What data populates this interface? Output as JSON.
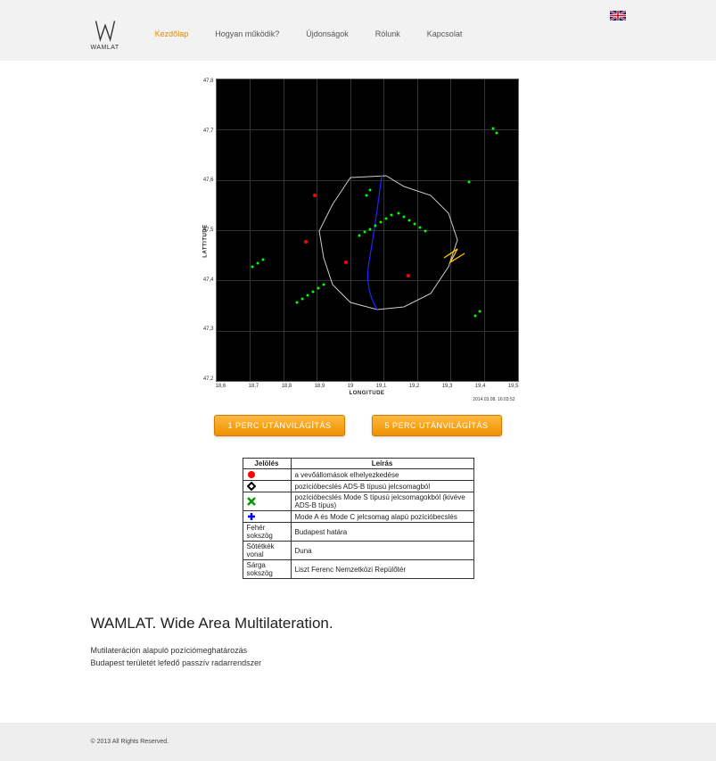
{
  "header": {
    "logo_text": "WAMLAT",
    "nav": [
      {
        "label": "Kezdőlap",
        "active": true
      },
      {
        "label": "Hogyan működik?",
        "active": false
      },
      {
        "label": "Újdonságok",
        "active": false
      },
      {
        "label": "Rólunk",
        "active": false
      },
      {
        "label": "Kapcsolat",
        "active": false
      }
    ],
    "flag_name": "uk-flag"
  },
  "chart_data": {
    "type": "scatter",
    "title": "",
    "xlabel": "LONGITUDE",
    "ylabel": "LATTITUDE",
    "xlim": [
      18.6,
      19.5
    ],
    "ylim": [
      47.2,
      47.8
    ],
    "xticks": [
      "18,6",
      "18,7",
      "18,8",
      "18,9",
      "19",
      "19,1",
      "19,2",
      "19,3",
      "19,4",
      "19,5"
    ],
    "yticks": [
      "47,8",
      "47,7",
      "47,6",
      "47,5",
      "47,4",
      "47,3",
      "47,2"
    ],
    "timestamp": "2014.03.08. 16:03:52",
    "series": [
      {
        "name": "receivers",
        "color": "#ff0000",
        "points": [
          [
            18.98,
            47.44
          ],
          [
            19.17,
            47.41
          ],
          [
            18.85,
            47.48
          ],
          [
            18.87,
            47.58
          ]
        ]
      },
      {
        "name": "ads-b",
        "color": "#00ff00",
        "points": [
          [
            18.68,
            47.42
          ],
          [
            18.7,
            47.43
          ],
          [
            18.72,
            47.44
          ],
          [
            18.82,
            47.35
          ],
          [
            18.84,
            47.36
          ],
          [
            18.86,
            47.37
          ],
          [
            18.88,
            47.38
          ],
          [
            18.9,
            47.39
          ],
          [
            19.04,
            47.48
          ],
          [
            19.06,
            47.49
          ],
          [
            19.08,
            47.5
          ],
          [
            19.1,
            47.51
          ],
          [
            19.12,
            47.52
          ],
          [
            19.14,
            47.53
          ],
          [
            19.16,
            47.52
          ],
          [
            19.18,
            47.51
          ],
          [
            19.2,
            47.5
          ],
          [
            19.22,
            47.49
          ],
          [
            19.24,
            47.48
          ],
          [
            19.35,
            47.6
          ],
          [
            19.38,
            47.3
          ],
          [
            18.97,
            47.56
          ],
          [
            18.99,
            47.575
          ],
          [
            19.33,
            47.73
          ],
          [
            19.34,
            47.34
          ],
          [
            19.32,
            47.33
          ]
        ]
      },
      {
        "name": "mode-s",
        "color": "#00ff00",
        "marker": "x",
        "points": []
      },
      {
        "name": "mode-ac",
        "color": "#0000ff",
        "marker": "+",
        "points": []
      }
    ],
    "boundary": "Budapest",
    "river": "Duna",
    "airport": "Liszt Ferenc Nemzetközi Repülőtér"
  },
  "buttons": {
    "btn1": "1 PERC UTÁNVILÁGÍTÁS",
    "btn5": "5 PERC UTÁNVILÁGÍTÁS"
  },
  "legend": {
    "headers": {
      "symbol": "Jelölés",
      "desc": "Leírás"
    },
    "rows": [
      {
        "symbol_type": "red-dot",
        "text": "",
        "desc": "a vevőállomások elhelyezkedése"
      },
      {
        "symbol_type": "diamond",
        "text": "",
        "desc": "pozícióbecslés ADS-B típusú jelcsomagból"
      },
      {
        "symbol_type": "green-x",
        "text": "",
        "desc": "pozícióbecslés Mode S típusú jelcsomagokból (kivéve ADS-B típus)"
      },
      {
        "symbol_type": "blue-plus",
        "text": "",
        "desc": "Mode A és Mode C jelcsomag alapú pozícióbecslés"
      },
      {
        "symbol_type": "text",
        "text": "Fehér sokszög",
        "desc": "Budapest határa"
      },
      {
        "symbol_type": "text",
        "text": "Sötétkék vonal",
        "desc": "Duna"
      },
      {
        "symbol_type": "text",
        "text": "Sárga sokszög",
        "desc": "Liszt Ferenc Nemzetközi Repülőtér"
      }
    ]
  },
  "intro": {
    "heading": "WAMLAT. Wide Area Multilateration.",
    "line1": "Mutilateráción alapuló pozíciómeghatározás",
    "line2": "Budapest területét lefedő passzív radarrendszer"
  },
  "footer": {
    "text": "© 2013     All Rights Reserved."
  }
}
